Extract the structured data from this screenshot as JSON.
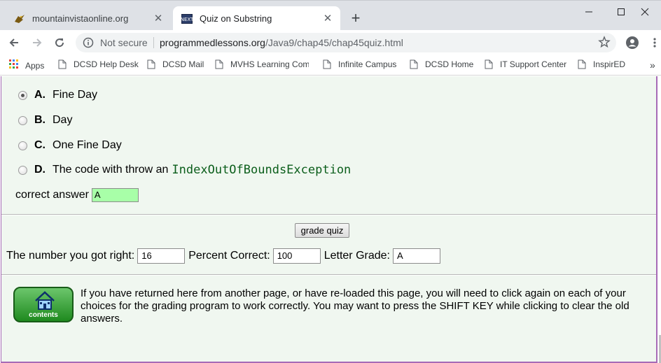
{
  "tabs": [
    {
      "title": "mountainvistaonline.org",
      "active": false,
      "favicon": "eagle-icon"
    },
    {
      "title": "Quiz on Substring",
      "active": true,
      "favicon": "next-icon"
    }
  ],
  "window_controls": [
    "minimize-icon",
    "maximize-icon",
    "close-icon"
  ],
  "address_bar": {
    "security": "Not secure",
    "host": "programmedlessons.org",
    "path": "/Java9/chap45/chap45quiz.html"
  },
  "bookmarks": [
    "Apps",
    "DCSD Help Desk",
    "DCSD Mail",
    "MVHS Learning Com",
    "Infinite Campus",
    "DCSD Home",
    "IT Support Center",
    "InspirED"
  ],
  "quiz": {
    "options": [
      {
        "letter": "A.",
        "text": "Fine Day",
        "code": "",
        "checked": true
      },
      {
        "letter": "B.",
        "text": "Day",
        "code": "",
        "checked": false
      },
      {
        "letter": "C.",
        "text": "One Fine Day",
        "code": "",
        "checked": false
      },
      {
        "letter": "D.",
        "text": "The code with throw an",
        "code": "IndexOutOfBoundsException",
        "checked": false
      }
    ],
    "correct_label": "correct answer",
    "correct_value": "A",
    "grade_button": "grade quiz",
    "right_label": "The number you got right:",
    "right_value": "16",
    "percent_label": "Percent Correct:",
    "percent_value": "100",
    "grade_label": "Letter Grade:",
    "grade_value": "A",
    "contents_label": "contents",
    "note": "If you have returned here from another page, or have re-loaded this page, you will need to click again on each of your choices for the grading program to work correctly. You may want to press the SHIFT KEY while clicking to clear the old answers."
  },
  "colors": {
    "page_bg": "#f0f7f0",
    "border": "#a76ab6",
    "answer_highlight": "#a8ffa8",
    "code": "#0b5e1b"
  }
}
